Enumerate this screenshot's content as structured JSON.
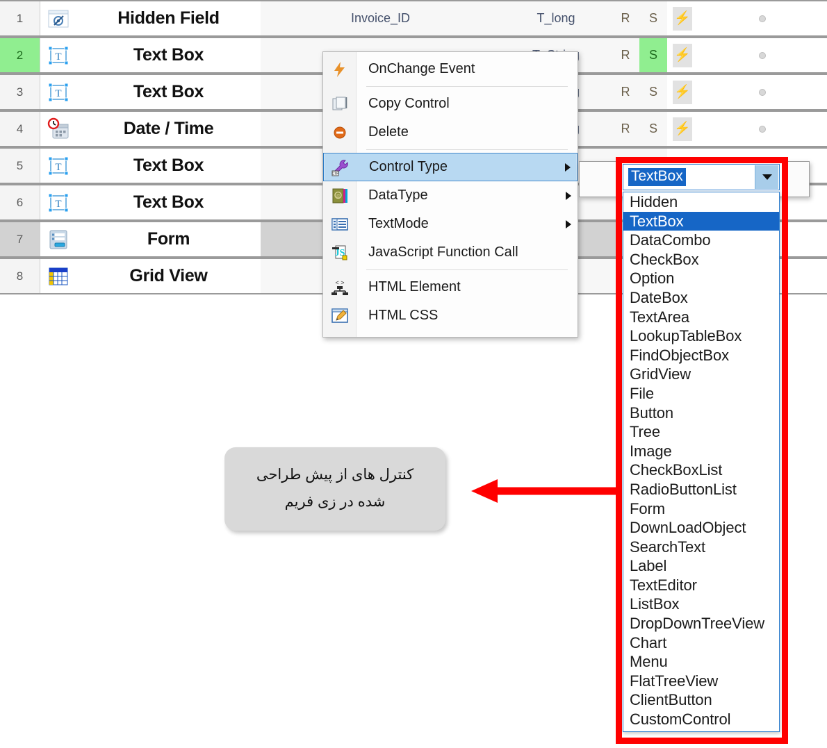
{
  "grid": {
    "columns": [
      "row_number",
      "control_icon",
      "control_name",
      "field_name",
      "data_type",
      "required_flag",
      "save_flag",
      "event_button",
      "status_dot"
    ],
    "rows": [
      {
        "num": "1",
        "icon": "hidden-field-icon",
        "name": "Hidden Field",
        "field": "Invoice_ID",
        "type": "T_long",
        "r": "R",
        "s": "S",
        "selected": false,
        "alt": false
      },
      {
        "num": "2",
        "icon": "text-box-icon",
        "name": "Text Box",
        "field": "",
        "type": "T_String",
        "r": "R",
        "s": "S",
        "selected": true,
        "alt": false
      },
      {
        "num": "3",
        "icon": "text-box-icon",
        "name": "Text Box",
        "field": "",
        "type": "T_String",
        "r": "R",
        "s": "S",
        "selected": false,
        "alt": false
      },
      {
        "num": "4",
        "icon": "date-time-icon",
        "name": "Date / Time",
        "field": "",
        "type": "T_String",
        "r": "R",
        "s": "S",
        "selected": false,
        "alt": false
      },
      {
        "num": "5",
        "icon": "text-box-icon",
        "name": "Text Box",
        "field": "",
        "type": "",
        "r": "",
        "s": "",
        "selected": false,
        "alt": false
      },
      {
        "num": "6",
        "icon": "text-box-icon",
        "name": "Text Box",
        "field": "",
        "type": "",
        "r": "",
        "s": "",
        "selected": false,
        "alt": false
      },
      {
        "num": "7",
        "icon": "form-icon",
        "name": "Form",
        "field": "",
        "type": "",
        "r": "",
        "s": "",
        "selected": false,
        "alt": true
      },
      {
        "num": "8",
        "icon": "grid-view-icon",
        "name": "Grid View",
        "field": "",
        "type": "",
        "r": "",
        "s": "",
        "selected": false,
        "alt": false
      }
    ]
  },
  "context_menu": {
    "items": [
      {
        "label": "OnChange Event",
        "icon": "lightning-bolt-icon",
        "submenu": false,
        "highlighted": false,
        "separator_after": true
      },
      {
        "label": "Copy Control",
        "icon": "copy-icon",
        "submenu": false,
        "highlighted": false,
        "separator_after": false
      },
      {
        "label": "Delete",
        "icon": "delete-icon",
        "submenu": false,
        "highlighted": false,
        "separator_after": true
      },
      {
        "label": "Control Type",
        "icon": "wrench-icon",
        "submenu": true,
        "highlighted": true,
        "separator_after": false
      },
      {
        "label": "DataType",
        "icon": "datatype-book-icon",
        "submenu": true,
        "highlighted": false,
        "separator_after": false
      },
      {
        "label": "TextMode",
        "icon": "textmode-icon",
        "submenu": true,
        "highlighted": false,
        "separator_after": false
      },
      {
        "label": "JavaScript Function Call",
        "icon": "javascript-icon",
        "submenu": false,
        "highlighted": false,
        "separator_after": true
      },
      {
        "label": "HTML Element",
        "icon": "html-element-icon",
        "submenu": false,
        "highlighted": false,
        "separator_after": false
      },
      {
        "label": "HTML CSS",
        "icon": "html-css-icon",
        "submenu": false,
        "highlighted": false,
        "separator_after": false
      }
    ]
  },
  "control_type_combo": {
    "value": "TextBox",
    "dropdown_icon": "chevron-down-icon",
    "selected_option": "TextBox",
    "options": [
      "Hidden",
      "TextBox",
      "DataCombo",
      "CheckBox",
      "Option",
      "DateBox",
      "TextArea",
      "LookupTableBox",
      "FindObjectBox",
      "GridView",
      "File",
      "Button",
      "Tree",
      "Image",
      "CheckBoxList",
      "RadioButtonList",
      "Form",
      "DownLoadObject",
      "SearchText",
      "Label",
      "TextEditor",
      "ListBox",
      "DropDownTreeView",
      "Chart",
      "Menu",
      "FlatTreeView",
      "ClientButton",
      "CustomControl"
    ]
  },
  "callout": {
    "line1": "کنترل های از پیش طراحی",
    "line2": "شده در زی فریم"
  },
  "colors": {
    "highlight_red": "#ff0000",
    "selection_green": "#90ee90",
    "combo_blue": "#1666c6",
    "menu_highlight": "#b8d9f2"
  }
}
